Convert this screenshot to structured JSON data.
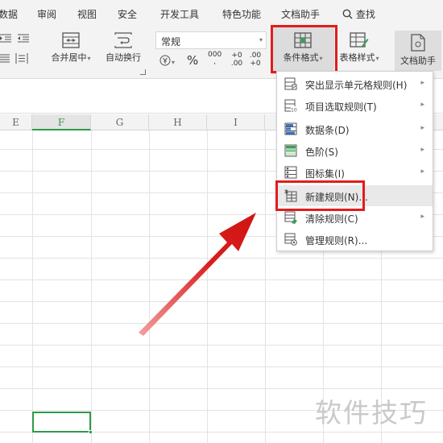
{
  "menubar": {
    "tabs": [
      "数据",
      "审阅",
      "视图",
      "安全",
      "开发工具",
      "特色功能",
      "文档助手"
    ],
    "search_label": "查找"
  },
  "ribbon": {
    "merge_center_label": "合并居中",
    "wrap_text_label": "自动换行",
    "number_format_value": "常规",
    "percent_symbol": "%",
    "thousands_label": "000",
    "inc_decimal_label": "+0 .00",
    "dec_decimal_label": ".00 +0",
    "conditional_format_label": "条件格式",
    "table_style_label": "表格样式",
    "doc_assistant_label": "文档助手"
  },
  "columns": [
    "E",
    "F",
    "G",
    "H",
    "I"
  ],
  "active_column": "F",
  "dropdown_menu": {
    "items": [
      {
        "label": "突出显示单元格规则(H)",
        "icon": "highlight-rules-icon",
        "submenu": true
      },
      {
        "label": "项目选取规则(T)",
        "icon": "top-bottom-rules-icon",
        "submenu": true
      },
      {
        "label": "数据条(D)",
        "icon": "data-bars-icon",
        "submenu": true
      },
      {
        "label": "色阶(S)",
        "icon": "color-scales-icon",
        "submenu": true
      },
      {
        "label": "图标集(I)",
        "icon": "icon-sets-icon",
        "submenu": true
      },
      {
        "label": "新建规则(N)...",
        "icon": "new-rule-icon",
        "submenu": false
      },
      {
        "label": "清除规则(C)",
        "icon": "clear-rules-icon",
        "submenu": true
      },
      {
        "label": "管理规则(R)...",
        "icon": "manage-rules-icon",
        "submenu": false
      }
    ]
  },
  "watermark": "软件技巧",
  "colors": {
    "highlight": "#e21c1c",
    "arrow": "#e21c1c",
    "selection": "#2f9a4b"
  }
}
